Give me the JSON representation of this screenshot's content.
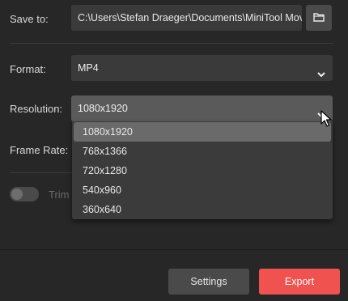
{
  "save_to": {
    "label": "Save to:",
    "path": "C:\\Users\\Stefan Draeger\\Documents\\MiniTool Mov",
    "browse_icon": "folder-icon"
  },
  "format": {
    "label": "Format:",
    "value": "MP4"
  },
  "resolution": {
    "label": "Resolution:",
    "value": "1080x1920",
    "options": [
      "1080x1920",
      "768x1366",
      "720x1280",
      "540x960",
      "360x640"
    ]
  },
  "frame_rate": {
    "label": "Frame Rate:"
  },
  "trim": {
    "label": "Trim",
    "enabled": false
  },
  "buttons": {
    "settings": "Settings",
    "export": "Export"
  },
  "colors": {
    "background": "#272727",
    "field": "#3a3a3a",
    "export_accent": "#f0524f"
  }
}
